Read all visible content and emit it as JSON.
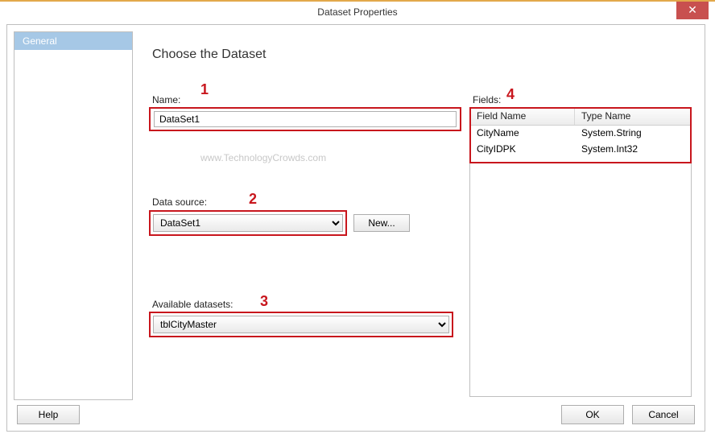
{
  "window": {
    "title": "Dataset Properties",
    "close_glyph": "✕"
  },
  "sidebar": {
    "items": [
      {
        "label": "General"
      }
    ]
  },
  "main": {
    "heading": "Choose the Dataset",
    "name_label": "Name:",
    "name_value": "DataSet1",
    "watermark": "www.TechnologyCrowds.com",
    "data_source_label": "Data source:",
    "data_source_value": "DataSet1",
    "new_button": "New...",
    "available_label": "Available datasets:",
    "available_value": "tblCityMaster",
    "fields_label": "Fields:",
    "fields_table": {
      "headers": [
        "Field Name",
        "Type Name"
      ],
      "rows": [
        {
          "name": "CityName",
          "type": "System.String"
        },
        {
          "name": "CityIDPK",
          "type": "System.Int32"
        }
      ]
    }
  },
  "annotations": {
    "n1": "1",
    "n2": "2",
    "n3": "3",
    "n4": "4",
    "color": "#c8161d"
  },
  "footer": {
    "help": "Help",
    "ok": "OK",
    "cancel": "Cancel"
  }
}
